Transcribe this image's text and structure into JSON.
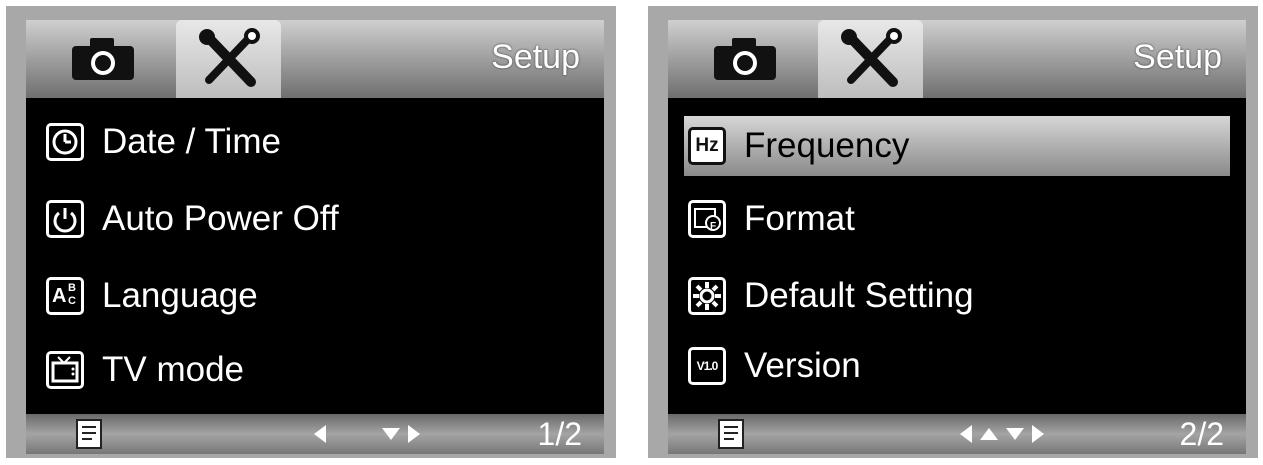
{
  "screens": [
    {
      "header": {
        "title": "Setup",
        "tabs": [
          "camera-icon",
          "tools-icon"
        ]
      },
      "items": [
        {
          "label": "Date / Time",
          "icon": "clock-icon"
        },
        {
          "label": "Auto Power Off",
          "icon": "power-icon"
        },
        {
          "label": "Language",
          "icon": "language-icon"
        },
        {
          "label": "TV mode",
          "icon": "tv-icon"
        }
      ],
      "footer": {
        "page": "1/2",
        "icon": "menu-icon",
        "arrows": [
          "left",
          "down",
          "right"
        ]
      }
    },
    {
      "header": {
        "title": "Setup",
        "tabs": [
          "camera-icon",
          "tools-icon"
        ]
      },
      "items": [
        {
          "label": "Frequency",
          "icon": "hz-icon",
          "selected": true
        },
        {
          "label": "Format",
          "icon": "format-card-icon"
        },
        {
          "label": "Default Setting",
          "icon": "default-setting-icon"
        },
        {
          "label": "Version",
          "icon": "version-icon"
        }
      ],
      "footer": {
        "page": "2/2",
        "icon": "menu-icon",
        "arrows": [
          "left",
          "up",
          "down",
          "right"
        ]
      }
    }
  ],
  "colors": {
    "background": "#000000",
    "header": "#9a9a9a",
    "selected": "#b0b0b0",
    "text": "#ffffff"
  },
  "icon_text": {
    "hz": "Hz",
    "language_a": "A",
    "language_b": "B",
    "language_c": "C",
    "format_f": "F",
    "version": "V1.0"
  }
}
